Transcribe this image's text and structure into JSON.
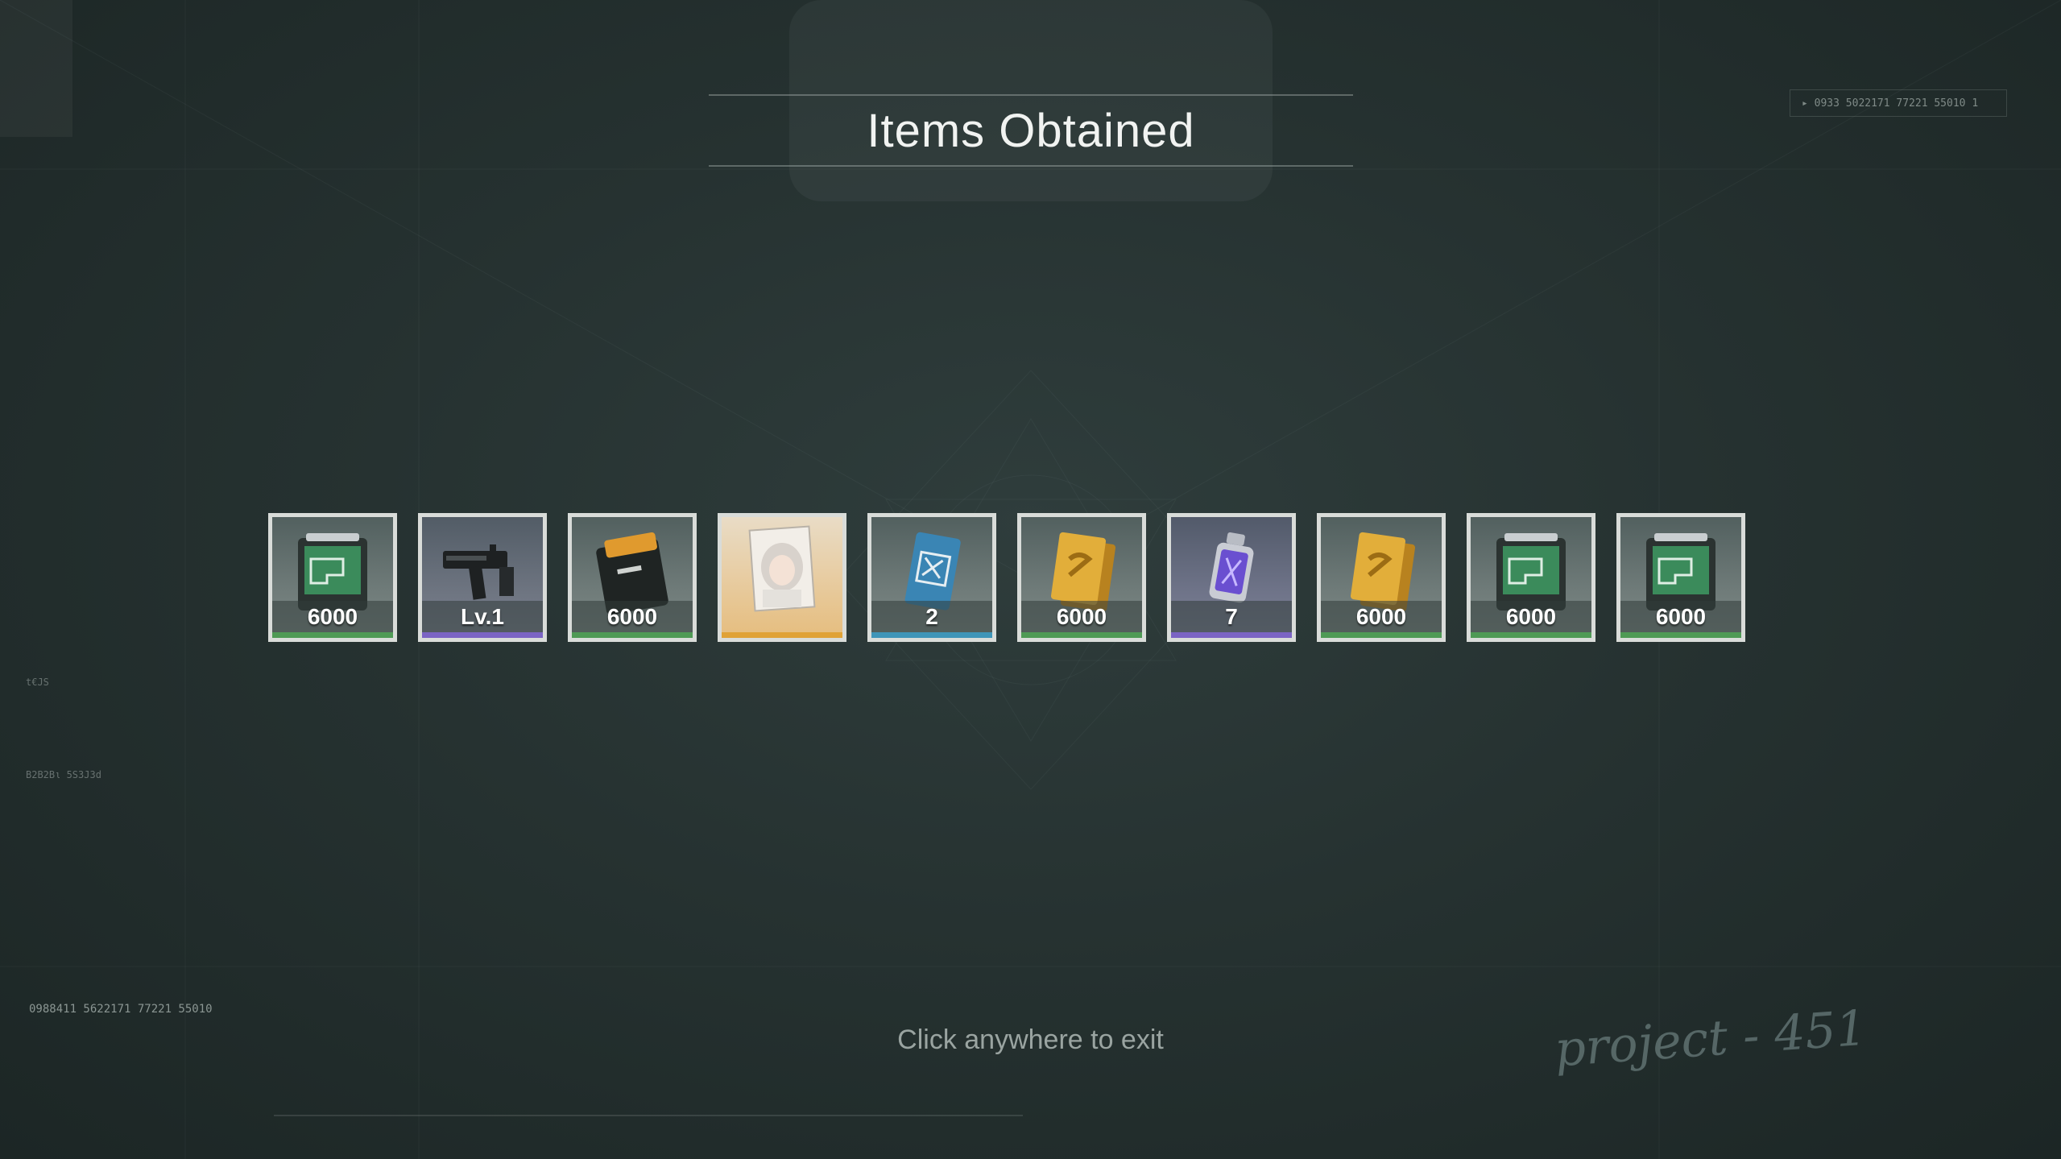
{
  "title": "Items Obtained",
  "exit_hint": "Click anywhere to exit",
  "code_top": "▸ 0933  5022171  77221  55010 1",
  "code_bottom": "0988411  5622171  77221  55010",
  "brand_text": "project - 451",
  "side_codes": [
    "t€JS",
    "B2B2Bι 5S3J3d"
  ],
  "colors": {
    "rarity_green": "#4f9a55",
    "rarity_purple": "#7b64c4",
    "rarity_gold": "#e0a236",
    "rarity_blue": "#3f95b8"
  },
  "items": [
    {
      "name": "Weapon Blueprint Case",
      "icon": "case-green-icon",
      "label": "6000",
      "rarity": "green"
    },
    {
      "name": "Submachine Gun",
      "icon": "smg-weapon-icon",
      "label": "Lv.1",
      "rarity": "purple"
    },
    {
      "name": "Orange Case",
      "icon": "case-orange-icon",
      "label": "6000",
      "rarity": "green"
    },
    {
      "name": "Character Card",
      "icon": "character-portrait-icon",
      "label": "",
      "rarity": "gold"
    },
    {
      "name": "Access Card",
      "icon": "blue-card-icon",
      "label": "2",
      "rarity": "blue"
    },
    {
      "name": "Gold Bars",
      "icon": "gold-bar-icon",
      "label": "6000",
      "rarity": "green"
    },
    {
      "name": "Energy Canister",
      "icon": "canister-icon",
      "label": "7",
      "rarity": "purple"
    },
    {
      "name": "Gold Bars",
      "icon": "gold-bar-icon",
      "label": "6000",
      "rarity": "green"
    },
    {
      "name": "Weapon Blueprint Case",
      "icon": "case-green-icon",
      "label": "6000",
      "rarity": "green"
    },
    {
      "name": "Weapon Blueprint Case",
      "icon": "case-green-icon",
      "label": "6000",
      "rarity": "green"
    }
  ]
}
